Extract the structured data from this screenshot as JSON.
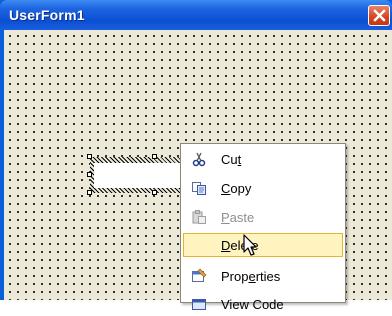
{
  "window": {
    "title": "UserForm1",
    "accent": "#0b4fd2",
    "close_icon": "close-icon"
  },
  "form": {
    "background": "#ece9d8",
    "grid": "dotted"
  },
  "context_menu": {
    "items": [
      {
        "pre": "Cu",
        "ul": "t",
        "post": "",
        "icon": "scissors-icon",
        "disabled": false
      },
      {
        "pre": "",
        "ul": "C",
        "post": "opy",
        "icon": "copy-icon",
        "disabled": false
      },
      {
        "pre": "",
        "ul": "P",
        "post": "aste",
        "icon": "paste-icon",
        "disabled": true
      },
      {
        "pre": "",
        "ul": "D",
        "post": "elete",
        "icon": "delete-icon",
        "disabled": false,
        "hover": true
      },
      {
        "pre": "Prop",
        "ul": "e",
        "post": "rties",
        "icon": "properties-icon",
        "disabled": false
      },
      {
        "pre": "View Code",
        "ul": "",
        "post": "",
        "icon": "view-code-icon",
        "disabled": false
      }
    ]
  }
}
